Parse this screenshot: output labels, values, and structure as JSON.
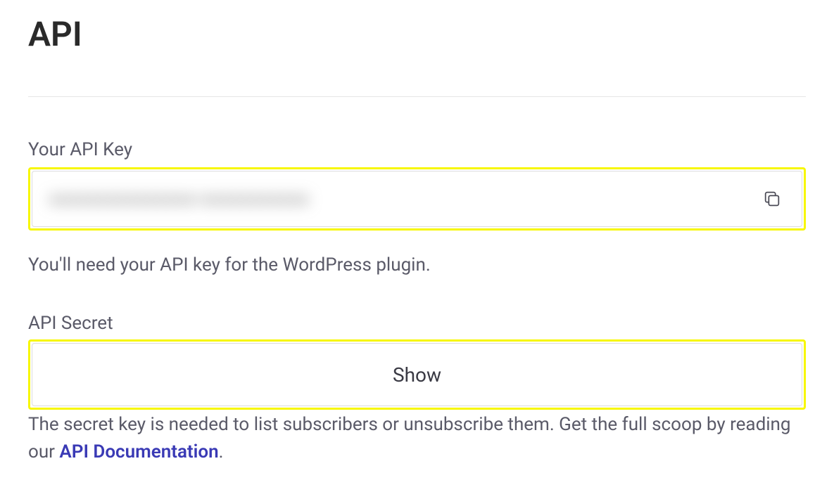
{
  "page": {
    "title": "API"
  },
  "apiKey": {
    "label": "Your API Key",
    "maskedValue": "xxxxxxxxxxxxxxx-xxxxxxxxxxx",
    "helpText": "You'll need your API key for the WordPress plugin."
  },
  "apiSecret": {
    "label": "API Secret",
    "showButton": "Show",
    "helpPrefix": "The secret key is needed to list subscribers or unsubscribe them. Get the full scoop by reading our ",
    "docLinkText": "API Documentation",
    "helpSuffix": "."
  }
}
